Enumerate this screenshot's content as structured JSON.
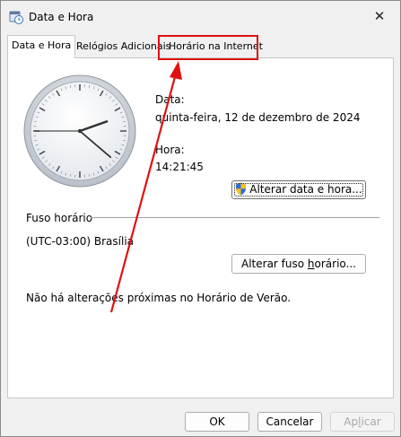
{
  "window": {
    "title": "Data e Hora",
    "close_glyph": "✕"
  },
  "tabs": [
    {
      "label": "Data e Hora"
    },
    {
      "label": "Relógios Adicionais"
    },
    {
      "label": "Horário na Internet"
    }
  ],
  "datetime": {
    "date_label": "Data:",
    "date_value": "quinta-feira, 12 de dezembro de 2024",
    "time_label": "Hora:",
    "time_value": "14:21:45",
    "change_button": "Alterar data e hora..."
  },
  "timezone": {
    "group_label": "Fuso horário",
    "value": "(UTC-03:00) Brasília",
    "change_button_prefix": "Alterar fuso ",
    "change_button_underlined": "h",
    "change_button_suffix": "orário...",
    "dst_note": "Não há alterações próximas no Horário de Verão."
  },
  "footer": {
    "ok": "OK",
    "cancel": "Cancelar",
    "apply_prefix": "Ap",
    "apply_underlined": "l",
    "apply_suffix": "icar"
  },
  "clock": {
    "hour": 14,
    "minute": 21,
    "second": 45
  },
  "colors": {
    "annotation": "#e01010"
  },
  "icons": [
    "date-time-app-icon",
    "close-icon",
    "uac-shield-icon",
    "analog-clock",
    "annotation-arrow"
  ]
}
